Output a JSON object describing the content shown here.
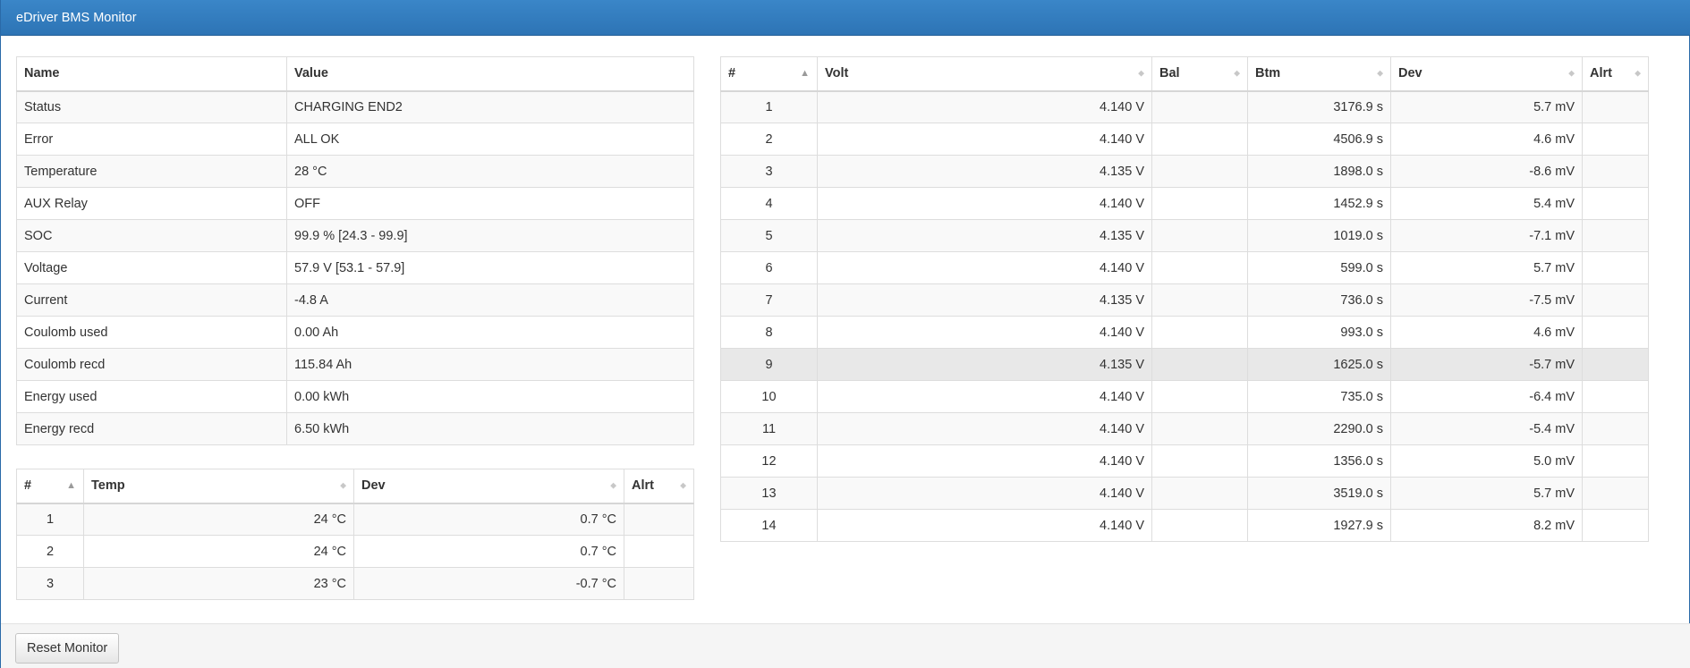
{
  "app": {
    "title": "eDriver BMS Monitor"
  },
  "status_table": {
    "headers": [
      "Name",
      "Value"
    ],
    "rows": [
      [
        "Status",
        "CHARGING END2"
      ],
      [
        "Error",
        "ALL OK"
      ],
      [
        "Temperature",
        "28 °C"
      ],
      [
        "AUX Relay",
        "OFF"
      ],
      [
        "SOC",
        "99.9 % [24.3 - 99.9]"
      ],
      [
        "Voltage",
        "57.9 V [53.1 - 57.9]"
      ],
      [
        "Current",
        "-4.8 A"
      ],
      [
        "Coulomb used",
        "0.00 Ah"
      ],
      [
        "Coulomb recd",
        "115.84 Ah"
      ],
      [
        "Energy used",
        "0.00 kWh"
      ],
      [
        "Energy recd",
        "6.50 kWh"
      ]
    ]
  },
  "temp_table": {
    "headers": [
      "#",
      "Temp",
      "Dev",
      "Alrt"
    ],
    "rows": [
      [
        "1",
        "24 °C",
        "0.7 °C",
        ""
      ],
      [
        "2",
        "24 °C",
        "0.7 °C",
        ""
      ],
      [
        "3",
        "23 °C",
        "-0.7 °C",
        ""
      ]
    ]
  },
  "cell_table": {
    "headers": [
      "#",
      "Volt",
      "Bal",
      "Btm",
      "Dev",
      "Alrt"
    ],
    "highlighted_row": 9,
    "rows": [
      [
        "1",
        "4.140 V",
        "",
        "3176.9 s",
        "5.7 mV",
        ""
      ],
      [
        "2",
        "4.140 V",
        "",
        "4506.9 s",
        "4.6 mV",
        ""
      ],
      [
        "3",
        "4.135 V",
        "",
        "1898.0 s",
        "-8.6 mV",
        ""
      ],
      [
        "4",
        "4.140 V",
        "",
        "1452.9 s",
        "5.4 mV",
        ""
      ],
      [
        "5",
        "4.135 V",
        "",
        "1019.0 s",
        "-7.1 mV",
        ""
      ],
      [
        "6",
        "4.140 V",
        "",
        "599.0 s",
        "5.7 mV",
        ""
      ],
      [
        "7",
        "4.135 V",
        "",
        "736.0 s",
        "-7.5 mV",
        ""
      ],
      [
        "8",
        "4.140 V",
        "",
        "993.0 s",
        "4.6 mV",
        ""
      ],
      [
        "9",
        "4.135 V",
        "",
        "1625.0 s",
        "-5.7 mV",
        ""
      ],
      [
        "10",
        "4.140 V",
        "",
        "735.0 s",
        "-6.4 mV",
        ""
      ],
      [
        "11",
        "4.140 V",
        "",
        "2290.0 s",
        "-5.4 mV",
        ""
      ],
      [
        "12",
        "4.140 V",
        "",
        "1356.0 s",
        "5.0 mV",
        ""
      ],
      [
        "13",
        "4.140 V",
        "",
        "3519.0 s",
        "5.7 mV",
        ""
      ],
      [
        "14",
        "4.140 V",
        "",
        "1927.9 s",
        "8.2 mV",
        ""
      ]
    ]
  },
  "footer": {
    "reset_label": "Reset Monitor"
  },
  "colors": {
    "titlebar": "#3a86c8",
    "row_highlight": "#e8e8e8",
    "stripe": "#f9f9f9"
  }
}
